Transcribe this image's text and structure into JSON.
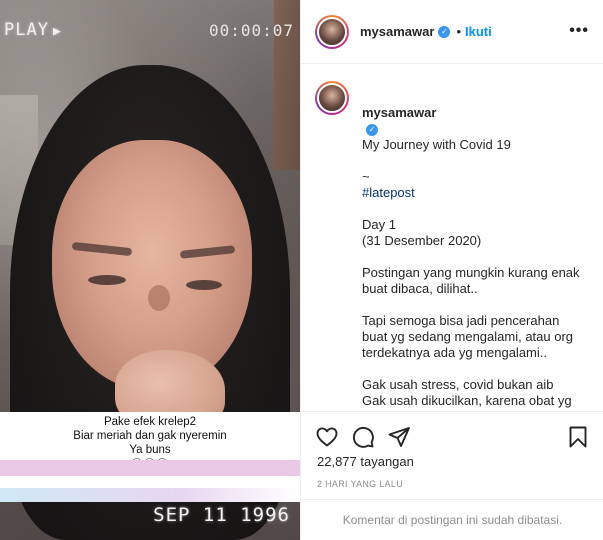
{
  "media": {
    "vhs_play": "PLAY",
    "vhs_play_symbol": "▶",
    "vhs_time": "00:00:07",
    "vhs_date": "SEP 11 1996",
    "caption_lines": [
      "Pake efek krelep2",
      "Biar meriah dan gak nyeremin",
      "Ya buns"
    ],
    "caption_emoji": "😂😂😂"
  },
  "header": {
    "username": "mysamawar",
    "verified_mark": "✓",
    "separator": "•",
    "follow_label": "Ikuti",
    "more_label": "•••"
  },
  "post": {
    "username": "mysamawar",
    "verified_mark": "✓",
    "title": "My Journey with Covid 19",
    "tilde": "~",
    "hashtag": "#latepost",
    "day": "Day 1",
    "date": "(31 Desember 2020)",
    "para1": "Postingan yang mungkin kurang enak buat dibaca, dilihat..",
    "para2": "Tapi semoga bisa jadi pencerahan buat yg sedang mengalami, atau org terdekatnya ada yg mengalami..",
    "para3": "Gak usah stress, covid bukan aib\nGak usah dikucilkan, karena obat yg paling ampuh adalah hati yang bahagia..."
  },
  "actions": {
    "icons": [
      "heart-icon",
      "comment-icon",
      "share-icon",
      "bookmark-icon"
    ],
    "views": "22,877 tayangan",
    "time_ago": "2 HARI YANG LALU"
  },
  "footer": {
    "comments_disabled": "Komentar di postingan ini sudah dibatasi."
  },
  "colors": {
    "accent_blue": "#0095f6",
    "verified_blue": "#3897f0",
    "hashtag": "#00376b",
    "muted": "#8e8e8e"
  }
}
